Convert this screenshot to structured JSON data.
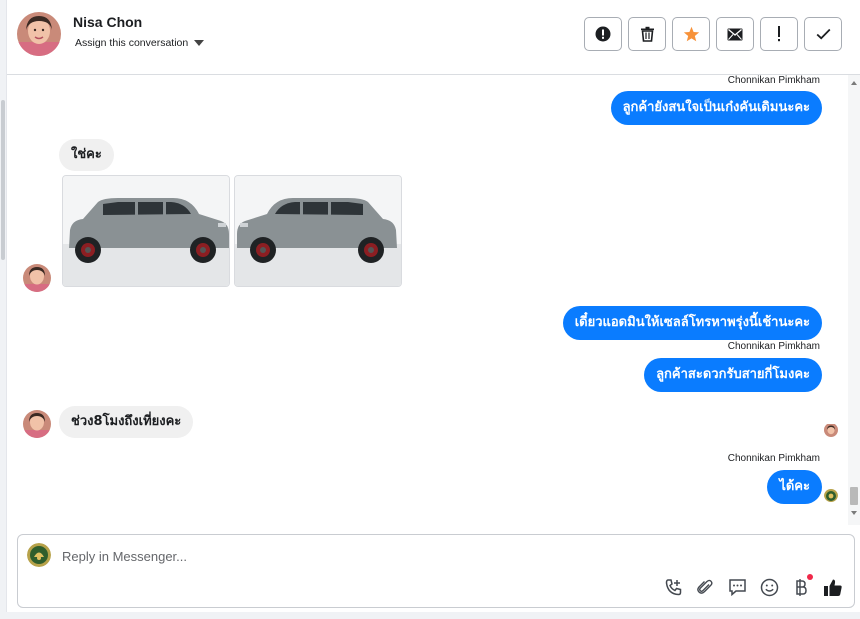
{
  "header": {
    "contact_name": "Nisa Chon",
    "assign_label": "Assign this conversation"
  },
  "actions": [
    {
      "name": "spam-button",
      "icon": "alert-circle-icon"
    },
    {
      "name": "delete-button",
      "icon": "trash-icon"
    },
    {
      "name": "star-button",
      "icon": "star-icon"
    },
    {
      "name": "mark-unread-button",
      "icon": "envelope-icon"
    },
    {
      "name": "follow-up-button",
      "icon": "exclamation-icon"
    },
    {
      "name": "mark-done-button",
      "icon": "checkmark-icon"
    }
  ],
  "messages": {
    "m1_sender": "Chonnikan Pimkham",
    "m1_text": "ลูกค้ายังสนใจเป็นเก๋งคันเดิมนะคะ",
    "m2_text": "ใช่คะ",
    "m3_text": "เดี๋ยวแอดมินให้เซลล์โทรหาพรุ่งนี้เช้านะคะ",
    "m4_sender": "Chonnikan Pimkham",
    "m4_text": "ลูกค้าสะดวกรับสายกี่โมงคะ",
    "m5_text": "ช่วง8โมงถึงเที่ยงคะ",
    "m6_sender": "Chonnikan Pimkham",
    "m6_text": "ได้คะ"
  },
  "composer": {
    "placeholder": "Reply in Messenger..."
  },
  "colors": {
    "outgoing_bubble": "#0a7cff",
    "incoming_bubble": "#f0f0f0",
    "star": "#f7923a",
    "notify_dot": "#f02849"
  }
}
